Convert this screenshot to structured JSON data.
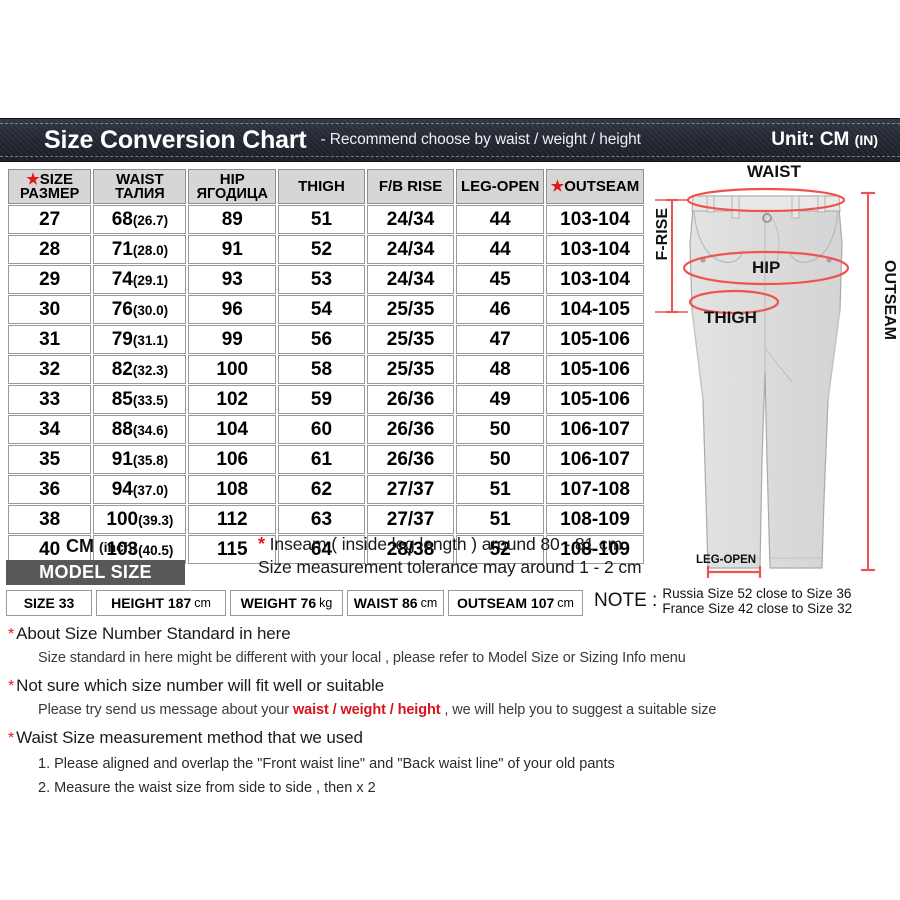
{
  "header": {
    "title": "Size Conversion Chart",
    "subtitle": "-  Recommend choose by waist / weight / height",
    "unit_main": "Unit: CM ",
    "unit_small": "(IN)"
  },
  "table": {
    "columns": [
      {
        "line1": "SIZE",
        "line2": "РАЗМЕР",
        "star": true
      },
      {
        "line1": "WAIST",
        "line2": "ТАЛИЯ",
        "star": false
      },
      {
        "line1": "HIP",
        "line2": "ЯГОДИЦА",
        "star": false
      },
      {
        "line1": "THIGH",
        "line2": "",
        "star": false
      },
      {
        "line1": "F/B RISE",
        "line2": "",
        "star": false
      },
      {
        "line1": "LEG-OPEN",
        "line2": "",
        "star": false
      },
      {
        "line1": "OUTSEAM",
        "line2": "",
        "star": true
      }
    ],
    "rows": [
      {
        "size": "27",
        "waist_cm": "68",
        "waist_in": "(26.7)",
        "hip": "89",
        "thigh": "51",
        "rise": "24/34",
        "leg_open": "44",
        "outseam": "103-104"
      },
      {
        "size": "28",
        "waist_cm": "71",
        "waist_in": "(28.0)",
        "hip": "91",
        "thigh": "52",
        "rise": "24/34",
        "leg_open": "44",
        "outseam": "103-104"
      },
      {
        "size": "29",
        "waist_cm": "74",
        "waist_in": "(29.1)",
        "hip": "93",
        "thigh": "53",
        "rise": "24/34",
        "leg_open": "45",
        "outseam": "103-104"
      },
      {
        "size": "30",
        "waist_cm": "76",
        "waist_in": "(30.0)",
        "hip": "96",
        "thigh": "54",
        "rise": "25/35",
        "leg_open": "46",
        "outseam": "104-105"
      },
      {
        "size": "31",
        "waist_cm": "79",
        "waist_in": "(31.1)",
        "hip": "99",
        "thigh": "56",
        "rise": "25/35",
        "leg_open": "47",
        "outseam": "105-106"
      },
      {
        "size": "32",
        "waist_cm": "82",
        "waist_in": "(32.3)",
        "hip": "100",
        "thigh": "58",
        "rise": "25/35",
        "leg_open": "48",
        "outseam": "105-106"
      },
      {
        "size": "33",
        "waist_cm": "85",
        "waist_in": "(33.5)",
        "hip": "102",
        "thigh": "59",
        "rise": "26/36",
        "leg_open": "49",
        "outseam": "105-106"
      },
      {
        "size": "34",
        "waist_cm": "88",
        "waist_in": "(34.6)",
        "hip": "104",
        "thigh": "60",
        "rise": "26/36",
        "leg_open": "50",
        "outseam": "106-107"
      },
      {
        "size": "35",
        "waist_cm": "91",
        "waist_in": "(35.8)",
        "hip": "106",
        "thigh": "61",
        "rise": "26/36",
        "leg_open": "50",
        "outseam": "106-107"
      },
      {
        "size": "36",
        "waist_cm": "94",
        "waist_in": "(37.0)",
        "hip": "108",
        "thigh": "62",
        "rise": "27/37",
        "leg_open": "51",
        "outseam": "107-108"
      },
      {
        "size": "38",
        "waist_cm": "100",
        "waist_in": "(39.3)",
        "hip": "112",
        "thigh": "63",
        "rise": "27/37",
        "leg_open": "51",
        "outseam": "108-109"
      },
      {
        "size": "40",
        "waist_cm": "103",
        "waist_in": "(40.5)",
        "hip": "115",
        "thigh": "64",
        "rise": "28/38",
        "leg_open": "52",
        "outseam": "108-109"
      }
    ],
    "unit_caption_main": "CM ",
    "unit_caption_small": "(inch)"
  },
  "inseam_notes": {
    "line1_star": "*",
    "line1": " Inseam ( inside leg length ) around  80 - 81 cm",
    "line2": "Size measurement tolerance may around 1 - 2 cm"
  },
  "model_size": {
    "band_label": "MODEL SIZE",
    "boxes": [
      {
        "label": "SIZE 33",
        "unit": ""
      },
      {
        "label": "HEIGHT 187",
        "unit": "cm"
      },
      {
        "label": "WEIGHT 76",
        "unit": "kg"
      },
      {
        "label": "WAIST 86",
        "unit": "cm"
      },
      {
        "label": "OUTSEAM 107",
        "unit": "cm"
      }
    ]
  },
  "note": {
    "label": "NOTE :",
    "line1": "Russia  Size 52 close to Size 36",
    "line2": "France Size 42 close to Size 32"
  },
  "footer": {
    "b1_head": "About Size Number Standard in here",
    "b1_sub": "Size standard in here might be different with your local , please refer to Model Size or Sizing Info menu",
    "b2_head": "Not sure which size number will fit well or suitable",
    "b2_sub_pre": "Please try send us message about your ",
    "b2_sub_hl": "waist / weight / height",
    "b2_sub_post": " , we will help you to suggest a suitable size",
    "b3_head": "Waist Size measurement method that we used",
    "b3_item1": "1. Please aligned and overlap the \"Front waist line\" and \"Back waist line\" of your old pants",
    "b3_item2": "2. Measure the waist size from side to side , then x 2"
  },
  "diagram": {
    "label_waist": "WAIST",
    "label_hip": "HIP",
    "label_thigh": "THIGH",
    "label_frise": "F-RISE",
    "label_outseam": "OUTSEAM",
    "label_legopen": "LEG-OPEN"
  },
  "colors": {
    "denim": "#232832",
    "accent_red": "#e8141c",
    "measure_red": "#ef5350",
    "header_gray": "#d6d6d6",
    "band_gray": "#585858"
  }
}
